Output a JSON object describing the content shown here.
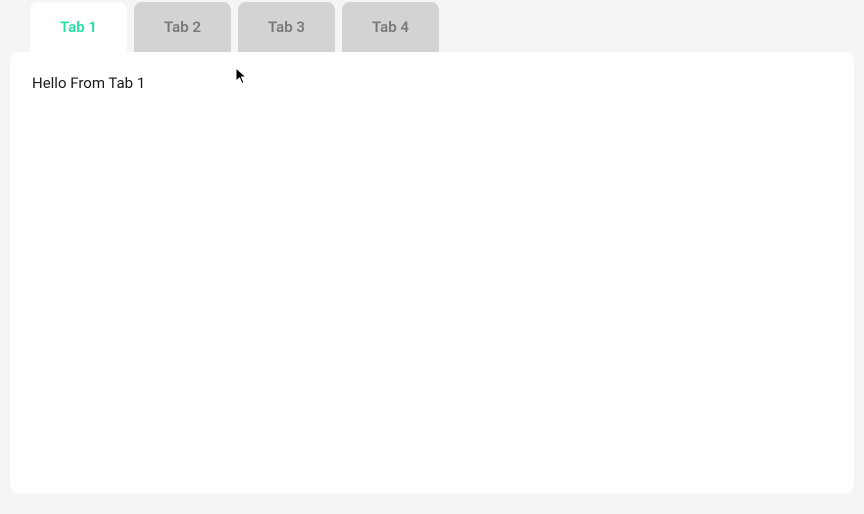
{
  "tabs": [
    {
      "label": "Tab 1",
      "active": true
    },
    {
      "label": "Tab 2",
      "active": false
    },
    {
      "label": "Tab 3",
      "active": false
    },
    {
      "label": "Tab 4",
      "active": false
    }
  ],
  "content": {
    "text": "Hello From Tab 1"
  },
  "colors": {
    "active_tab_text": "#26e0a6",
    "inactive_tab_bg": "#d3d3d3",
    "inactive_tab_text": "#7a7a7a",
    "page_bg": "#f5f5f5",
    "content_bg": "#ffffff"
  }
}
